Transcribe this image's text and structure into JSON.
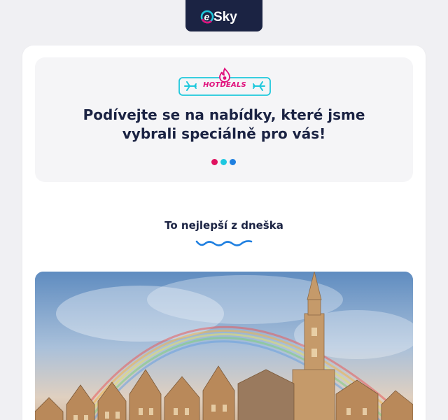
{
  "brand": {
    "name": "eSky",
    "colors": {
      "navy": "#1b2343",
      "pink": "#e0107c",
      "cyan": "#1ec8dc",
      "blue": "#1e7fe0"
    }
  },
  "hero": {
    "badge_text": "HOTDEALS",
    "badge_icons": [
      "plane-left-icon",
      "flame-icon",
      "plane-right-icon"
    ],
    "title": "Podívejte se na nabídky, které jsme vybrali speciálně pro vás!",
    "dot_colors": [
      "#e0115f",
      "#1ec8e0",
      "#1e7fe0"
    ]
  },
  "section": {
    "title": "To nejlepší z dneška"
  },
  "offer": {
    "image_subject": "city-square-with-rainbow"
  }
}
